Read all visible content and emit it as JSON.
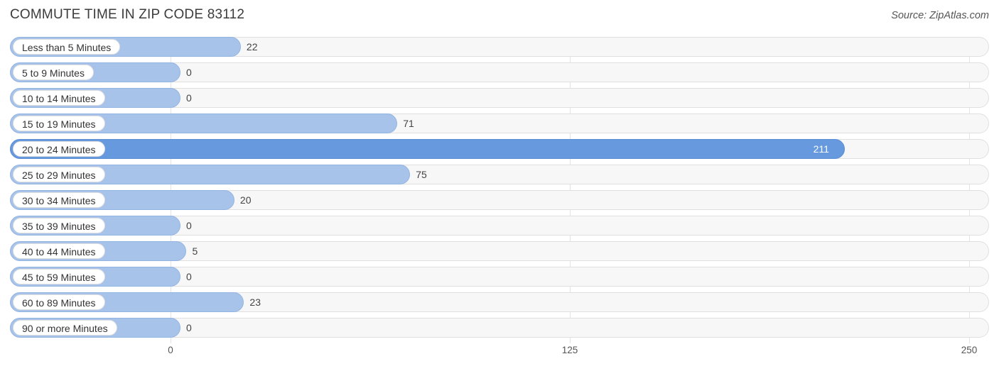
{
  "header": {
    "title": "COMMUTE TIME IN ZIP CODE 83112",
    "source": "Source: ZipAtlas.com"
  },
  "chart_data": {
    "type": "bar",
    "orientation": "horizontal",
    "title": "COMMUTE TIME IN ZIP CODE 83112",
    "xlabel": "",
    "ylabel": "",
    "xlim": [
      0,
      250
    ],
    "ticks": [
      "0",
      "125",
      "250"
    ],
    "grid": true,
    "legend": null,
    "highlight_category": "20 to 24 Minutes",
    "colors": {
      "bar": "#a7c3ea",
      "bar_highlight": "#6699dd",
      "track": "#f7f7f7",
      "grid": "#e3e3e3"
    },
    "categories": [
      "Less than 5 Minutes",
      "5 to 9 Minutes",
      "10 to 14 Minutes",
      "15 to 19 Minutes",
      "20 to 24 Minutes",
      "25 to 29 Minutes",
      "30 to 34 Minutes",
      "35 to 39 Minutes",
      "40 to 44 Minutes",
      "45 to 59 Minutes",
      "60 to 89 Minutes",
      "90 or more Minutes"
    ],
    "values": [
      22,
      0,
      0,
      71,
      211,
      75,
      20,
      0,
      5,
      0,
      23,
      0
    ],
    "value_labels": [
      "22",
      "0",
      "0",
      "71",
      "211",
      "75",
      "20",
      "0",
      "5",
      "0",
      "23",
      "0"
    ]
  }
}
